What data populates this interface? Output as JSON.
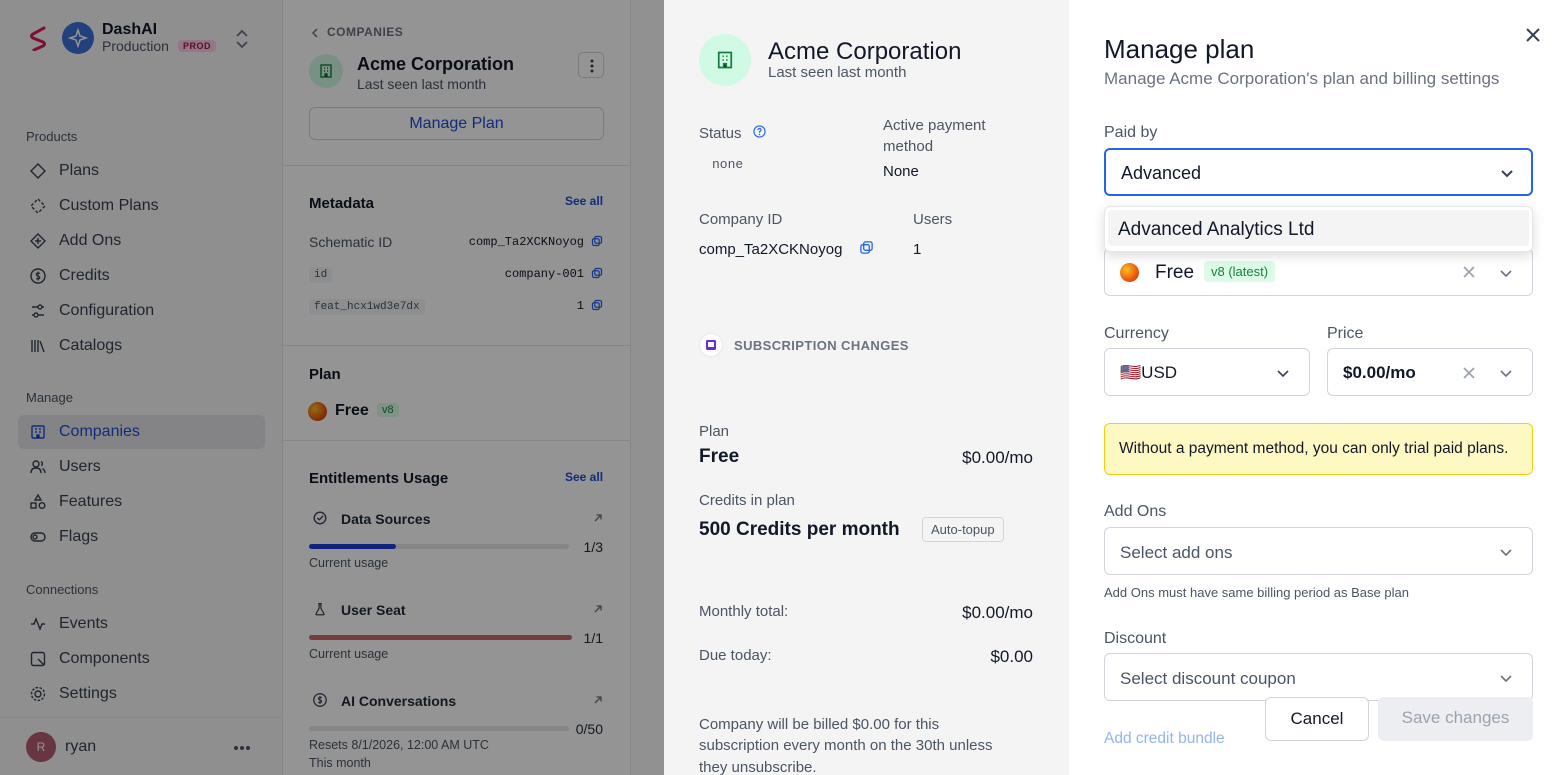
{
  "sidebar": {
    "app_name": "DashAI",
    "environment": "Production",
    "env_badge": "PROD",
    "sections": [
      {
        "title": "Products",
        "items": [
          {
            "label": "Plans",
            "icon": "diamond-icon"
          },
          {
            "label": "Custom Plans",
            "icon": "dashed-diamond-icon"
          },
          {
            "label": "Add Ons",
            "icon": "plus-diamond-icon"
          },
          {
            "label": "Credits",
            "icon": "dollar-circle-icon"
          },
          {
            "label": "Configuration",
            "icon": "sliders-icon"
          },
          {
            "label": "Catalogs",
            "icon": "library-icon"
          }
        ]
      },
      {
        "title": "Manage",
        "items": [
          {
            "label": "Companies",
            "icon": "building-icon",
            "active": true
          },
          {
            "label": "Users",
            "icon": "users-icon"
          },
          {
            "label": "Features",
            "icon": "shapes-icon"
          },
          {
            "label": "Flags",
            "icon": "toggle-icon"
          }
        ]
      },
      {
        "title": "Connections",
        "items": [
          {
            "label": "Events",
            "icon": "activity-icon"
          },
          {
            "label": "Components",
            "icon": "component-icon"
          },
          {
            "label": "Settings",
            "icon": "gear-icon"
          }
        ]
      }
    ],
    "user": {
      "initial": "R",
      "name": "ryan"
    }
  },
  "company": {
    "breadcrumb": "COMPANIES",
    "name": "Acme Corporation",
    "last_seen": "Last seen last month",
    "manage_plan_label": "Manage Plan",
    "metadata": {
      "title": "Metadata",
      "see_all": "See all",
      "rows": [
        {
          "key": "Schematic ID",
          "value": "comp_Ta2XCKNoyog"
        },
        {
          "key": "id",
          "value": "company-001"
        },
        {
          "key": "feat_hcx1wd3e7dx",
          "value": "1"
        }
      ]
    },
    "plan": {
      "title": "Plan",
      "name": "Free",
      "version": "v8"
    },
    "entitlements": {
      "title": "Entitlements Usage",
      "see_all": "See all",
      "items": [
        {
          "name": "Data Sources",
          "usage": "1/3",
          "fraction": 0.333,
          "sub": "Current usage",
          "color": "#1d3fd6",
          "icon": "check-circle-icon"
        },
        {
          "name": "User Seat",
          "usage": "1/1",
          "fraction": 1.0,
          "sub": "Current usage",
          "color": "#c96a6a",
          "icon": "flask-icon"
        },
        {
          "name": "AI Conversations",
          "usage": "0/50",
          "fraction": 0.0,
          "sub": "Resets 8/1/2026, 12:00 AM UTC",
          "sub2": "This month",
          "color": "#9ca3af",
          "icon": "dollar-circle-icon"
        }
      ]
    }
  },
  "summary": {
    "name": "Acme Corporation",
    "last_seen": "Last seen last month",
    "status_label": "Status",
    "status_value": "none",
    "payment_label": "Active payment method",
    "payment_value": "None",
    "company_id_label": "Company ID",
    "company_id_value": "comp_Ta2XCKNoyog",
    "users_label": "Users",
    "users_value": "1",
    "subscription_heading": "SUBSCRIPTION CHANGES",
    "plan_label": "Plan",
    "plan_value": "Free",
    "plan_price": "$0.00/mo",
    "credits_label": "Credits in plan",
    "credits_value": "500 Credits per month",
    "auto_topup": "Auto-topup",
    "monthly_total_label": "Monthly total:",
    "monthly_total_value": "$0.00/mo",
    "due_today_label": "Due today:",
    "due_today_value": "$0.00",
    "billing_note": [
      "Company will be billed $0.00 for this",
      "subscription every month on the 30th unless",
      "they unsubscribe."
    ]
  },
  "manage_plan": {
    "title": "Manage plan",
    "subtitle": "Manage Acme Corporation's plan and billing settings",
    "paid_by_label": "Paid by",
    "paid_by_value": "Advanced",
    "dropdown_option": "Advanced Analytics Ltd",
    "plan_value": "Free",
    "plan_version": "v8 (latest)",
    "currency_label": "Currency",
    "currency_value": "🇺🇸USD",
    "price_label": "Price",
    "price_value": "$0.00/mo",
    "warning": "Without a payment method, you can only trial paid plans.",
    "addons_label": "Add Ons",
    "addons_placeholder": "Select add ons",
    "addons_hint": "Add Ons must have same billing period as Base plan",
    "discount_label": "Discount",
    "discount_placeholder": "Select discount coupon",
    "add_credit_bundle": "Add credit bundle",
    "cancel_label": "Cancel",
    "save_label": "Save changes"
  }
}
